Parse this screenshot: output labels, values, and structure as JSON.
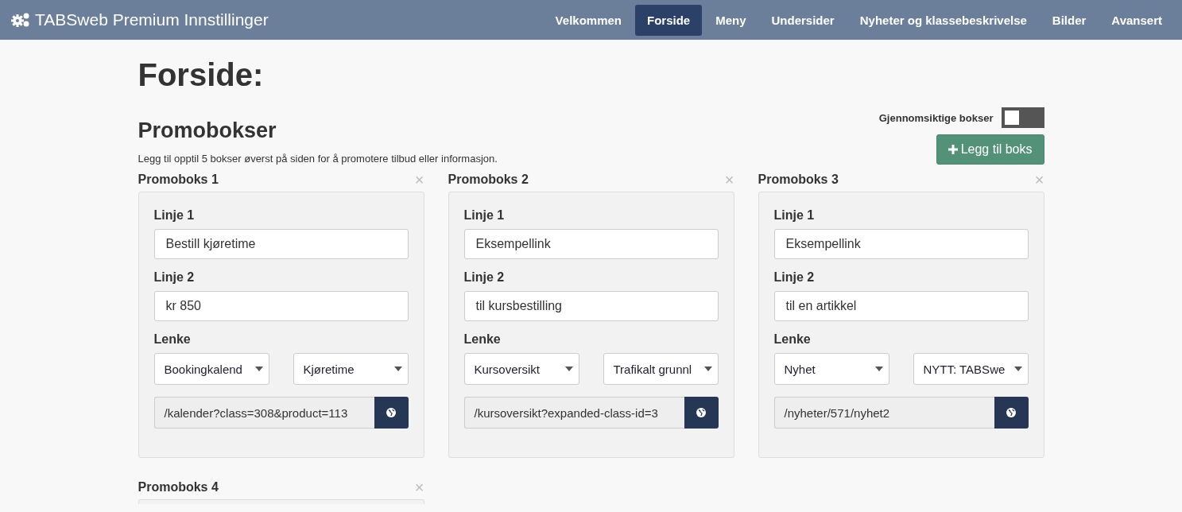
{
  "header": {
    "title": "TABSweb Premium Innstillinger",
    "nav": [
      {
        "label": "Velkommen",
        "selected": false
      },
      {
        "label": "Forside",
        "selected": true
      },
      {
        "label": "Meny",
        "selected": false
      },
      {
        "label": "Undersider",
        "selected": false
      },
      {
        "label": "Nyheter og klassebeskrivelse",
        "selected": false
      },
      {
        "label": "Bilder",
        "selected": false
      },
      {
        "label": "Avansert",
        "selected": false
      }
    ]
  },
  "page_title": "Forside:",
  "section": {
    "title": "Promobokser",
    "description": "Legg til opptil 5 bokser øverst på siden for å promotere tilbud eller informasjon.",
    "toggle": {
      "label": "Gjennomsiktige bokser",
      "on": false
    },
    "add_button": "Legg til boks"
  },
  "promo_boxes": [
    {
      "title": "Promoboks 1",
      "close": "×",
      "line1_label": "Linje 1",
      "line1": "Bestill kjøretime",
      "line2_label": "Linje 2",
      "line2": "kr 850",
      "link_label": "Lenke",
      "link_type": "Bookingkalend",
      "link_target": "Kjøretime",
      "url": "/kalender?class=308&product=113"
    },
    {
      "title": "Promoboks 2",
      "close": "×",
      "line1_label": "Linje 1",
      "line1": "Eksempellink",
      "line2_label": "Linje 2",
      "line2": "til kursbestilling",
      "link_label": "Lenke",
      "link_type": "Kursoversikt",
      "link_target": "Trafikalt grunnl",
      "url": "/kursoversikt?expanded-class-id=3"
    },
    {
      "title": "Promoboks 3",
      "close": "×",
      "line1_label": "Linje 1",
      "line1": "Eksempellink",
      "line2_label": "Linje 2",
      "line2": "til en artikkel",
      "link_label": "Lenke",
      "link_type": "Nyhet",
      "link_target": "NYTT: TABSwe",
      "url": "/nyheter/571/nyhet2"
    },
    {
      "title": "Promoboks 4",
      "close": "×"
    }
  ]
}
